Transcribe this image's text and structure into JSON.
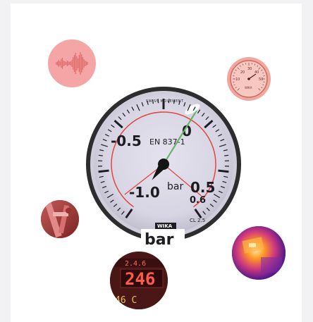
{
  "main_gauge": {
    "brand_arc": "SWISS MOVEMENT",
    "standard": "EN 837-1",
    "scale_labels": [
      "-1.0",
      "-0.5",
      "0",
      "0.5"
    ],
    "unit": "bar",
    "accuracy_class": "0.6",
    "cl_label": "CL 2.5",
    "brand": "WIKA",
    "under_label": "bar",
    "needle_value": 0.2
  },
  "thermometer_dial": {
    "scale_labels": [
      "20",
      "30",
      "40",
      "10",
      "50"
    ],
    "unit": "°C",
    "brand": "WIKA"
  },
  "digital_display": {
    "top_readout": "2.4.6",
    "main_readout": "246",
    "bottom_readout": "46 C"
  },
  "colors": {
    "circle_red": "#f5a5a5",
    "gauge_red": "#e0473e",
    "needle_green": "#44c96b",
    "thermal_purple": "#5a1a8c",
    "thermal_orange": "#ff9a24",
    "display_bg": "#5c1d1d",
    "display_digits": "#ff5a4a"
  },
  "icons": [
    "sound-wave-icon",
    "thermometer-dial-icon",
    "pipe-valve-photo",
    "thermal-image-photo",
    "digital-display-photo"
  ]
}
